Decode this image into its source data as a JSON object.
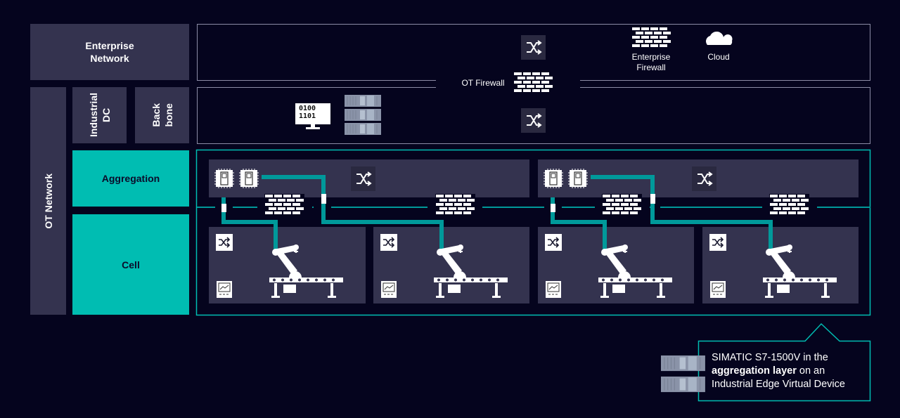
{
  "layers": {
    "enterprise_network": "Enterprise\nNetwork",
    "ot_network": "OT Network",
    "industrial_dc": "Industrial\nDC",
    "backbone": "Back\nbone",
    "aggregation": "Aggregation",
    "cell": "Cell"
  },
  "labels": {
    "enterprise_firewall": "Enterprise\nFirewall",
    "cloud": "Cloud",
    "ot_firewall": "OT Firewall",
    "binary_line1": "0100",
    "binary_line2": "1101"
  },
  "callout": {
    "line1": "SIMATIC  S7-1500V in the",
    "bold": "aggregation layer",
    "line2_rest": " on an",
    "line3": "Industrial  Edge Virtual Device"
  },
  "colors": {
    "background": "#05041e",
    "panel": "#34334f",
    "accent_teal": "#00bdb2",
    "connection_teal": "#00999a"
  }
}
